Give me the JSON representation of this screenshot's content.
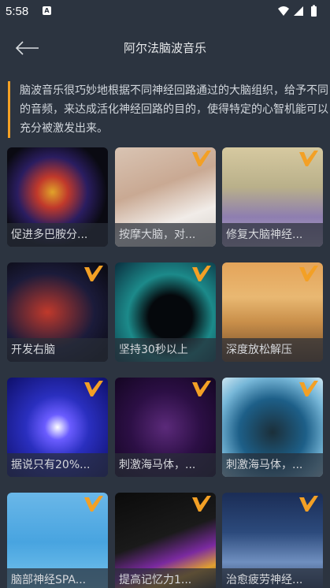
{
  "status": {
    "time": "5:58",
    "note_icon": "A"
  },
  "header": {
    "title": "阿尔法脑波音乐",
    "back_icon": "arrow-left-icon"
  },
  "intro": {
    "text": "脑波音乐很巧妙地根据不同神经回路通过的大脑组织，给予不同的音频，来达成活化神经回路的目的，使得特定的心智机能可以充分被激发出来。"
  },
  "cards": [
    {
      "label": "促进多巴胺分...",
      "vip": false
    },
    {
      "label": "按摩大脑，对...",
      "vip": true
    },
    {
      "label": "修复大脑神经...",
      "vip": true
    },
    {
      "label": "开发右脑",
      "vip": true
    },
    {
      "label": "坚持30秒以上",
      "vip": true
    },
    {
      "label": "深度放松解压",
      "vip": true
    },
    {
      "label": "据说只有20%...",
      "vip": true
    },
    {
      "label": "刺激海马体，...",
      "vip": true
    },
    {
      "label": "刺激海马体，...",
      "vip": true
    },
    {
      "label": "脑部神经SPA...",
      "vip": true
    },
    {
      "label": "提高记忆力1...",
      "vip": true
    },
    {
      "label": "治愈疲劳神经...",
      "vip": true
    }
  ],
  "colors": {
    "background": "#2c3440",
    "accent": "#f3a025"
  }
}
